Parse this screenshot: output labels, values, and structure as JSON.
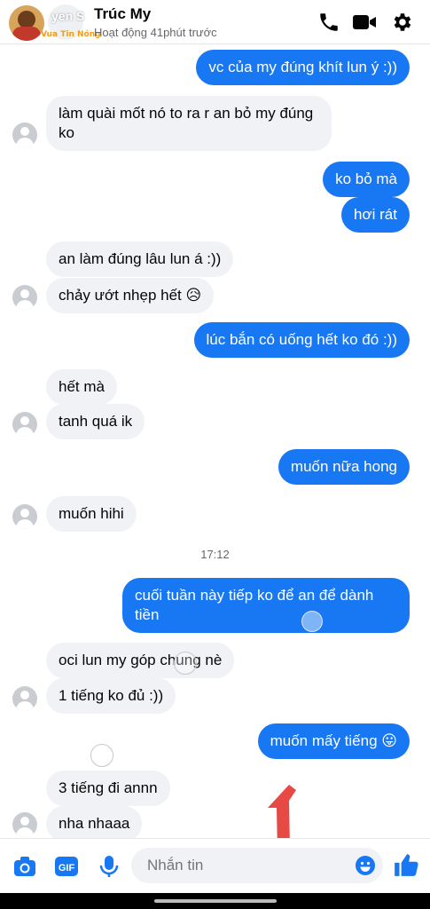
{
  "header": {
    "contact_name": "Trúc My",
    "status": "Hoạt động 41phút trước",
    "watermark": "Vua Tin Nóng",
    "watermark_label": "yen S"
  },
  "icons": {
    "back": "back-arrow-icon",
    "call": "phone-icon",
    "video": "video-camera-icon",
    "settings": "gear-icon",
    "camera": "camera-icon",
    "gif": "gif-icon",
    "mic": "microphone-icon",
    "emoji": "emoji-icon",
    "like": "thumbs-up-icon"
  },
  "colors": {
    "accent": "#1877f2",
    "incoming_bubble": "#f0f2f5",
    "overlay_arrow": "#e53935"
  },
  "messages": [
    {
      "dir": "out",
      "text": "vc của my đúng khít lun ý :))"
    },
    {
      "dir": "in",
      "text": "làm quài mốt nó to ra r an bỏ my đúng ko"
    },
    {
      "dir": "out",
      "text": "ko bỏ mà"
    },
    {
      "dir": "out",
      "text": "hơi rát"
    },
    {
      "dir": "in",
      "text": "an làm đúng lâu lun á :))"
    },
    {
      "dir": "in",
      "text": "chảy ướt nhẹp hết 😥"
    },
    {
      "dir": "out",
      "text": "lúc bắn có uống hết ko đó :))"
    },
    {
      "dir": "in",
      "text": "hết mà"
    },
    {
      "dir": "in",
      "text": "tanh quá ik"
    },
    {
      "dir": "out",
      "text": "muốn nữa hong"
    },
    {
      "dir": "in",
      "text": "muốn hihi"
    },
    {
      "dir": "out",
      "text": "cuối tuần này tiếp ko để an để dành tiền"
    },
    {
      "dir": "in",
      "text": "oci lun my góp chung nè"
    },
    {
      "dir": "in",
      "text": "1 tiếng ko đủ :))"
    },
    {
      "dir": "out",
      "text": "muốn mấy tiếng 😛"
    },
    {
      "dir": "in",
      "text": "3 tiếng đi annn"
    },
    {
      "dir": "in",
      "text": "nha nhaaa"
    }
  ],
  "timestamp": "17:12",
  "composer": {
    "placeholder": "Nhắn tin",
    "gif_label": "GIF"
  }
}
